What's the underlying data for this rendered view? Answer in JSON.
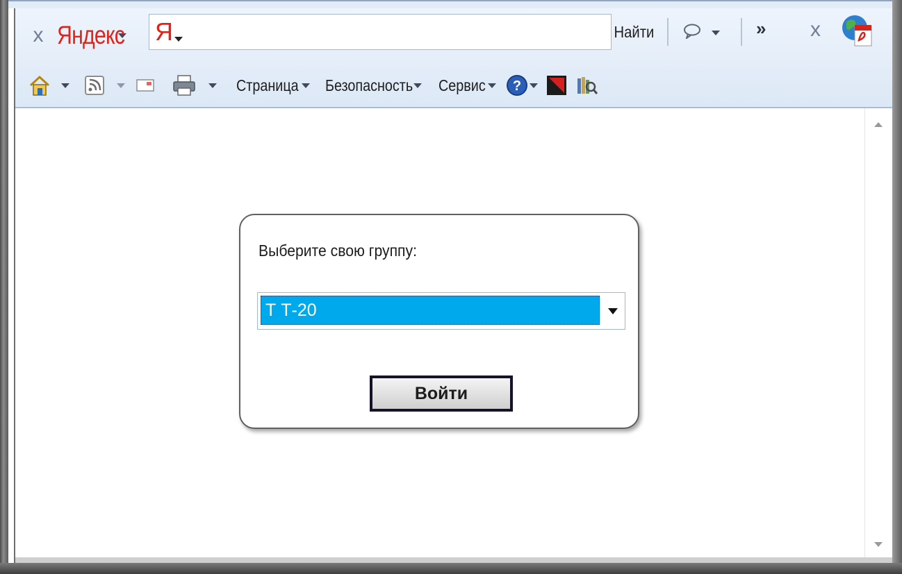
{
  "toolbar": {
    "close_glyph": "x",
    "yandex_logo_first": "Я",
    "yandex_logo_rest": "ндекс",
    "search_ya": "Я",
    "search_placeholder": "",
    "find_label": "Найти",
    "more_glyph": "»",
    "close2_glyph": "x"
  },
  "command_bar": {
    "page_label": "Страница",
    "security_label": "Безопасность",
    "tools_label": "Сервис"
  },
  "icons": {
    "home": "home-icon",
    "feeds": "feeds-icon",
    "mail": "mail-icon",
    "print": "print-icon",
    "help": "help-icon",
    "kaspersky": "kaspersky-icon",
    "research": "research-icon",
    "pdf": "pdf-globe-icon",
    "comment": "comment-icon"
  },
  "login": {
    "prompt": "Выберите свою группу:",
    "selected_group": "Т Т-20",
    "submit_label": "Войти"
  },
  "colors": {
    "selection": "#00a8ec",
    "brand_red": "#e2231a",
    "toolbar_bg": "#dce8f6"
  }
}
